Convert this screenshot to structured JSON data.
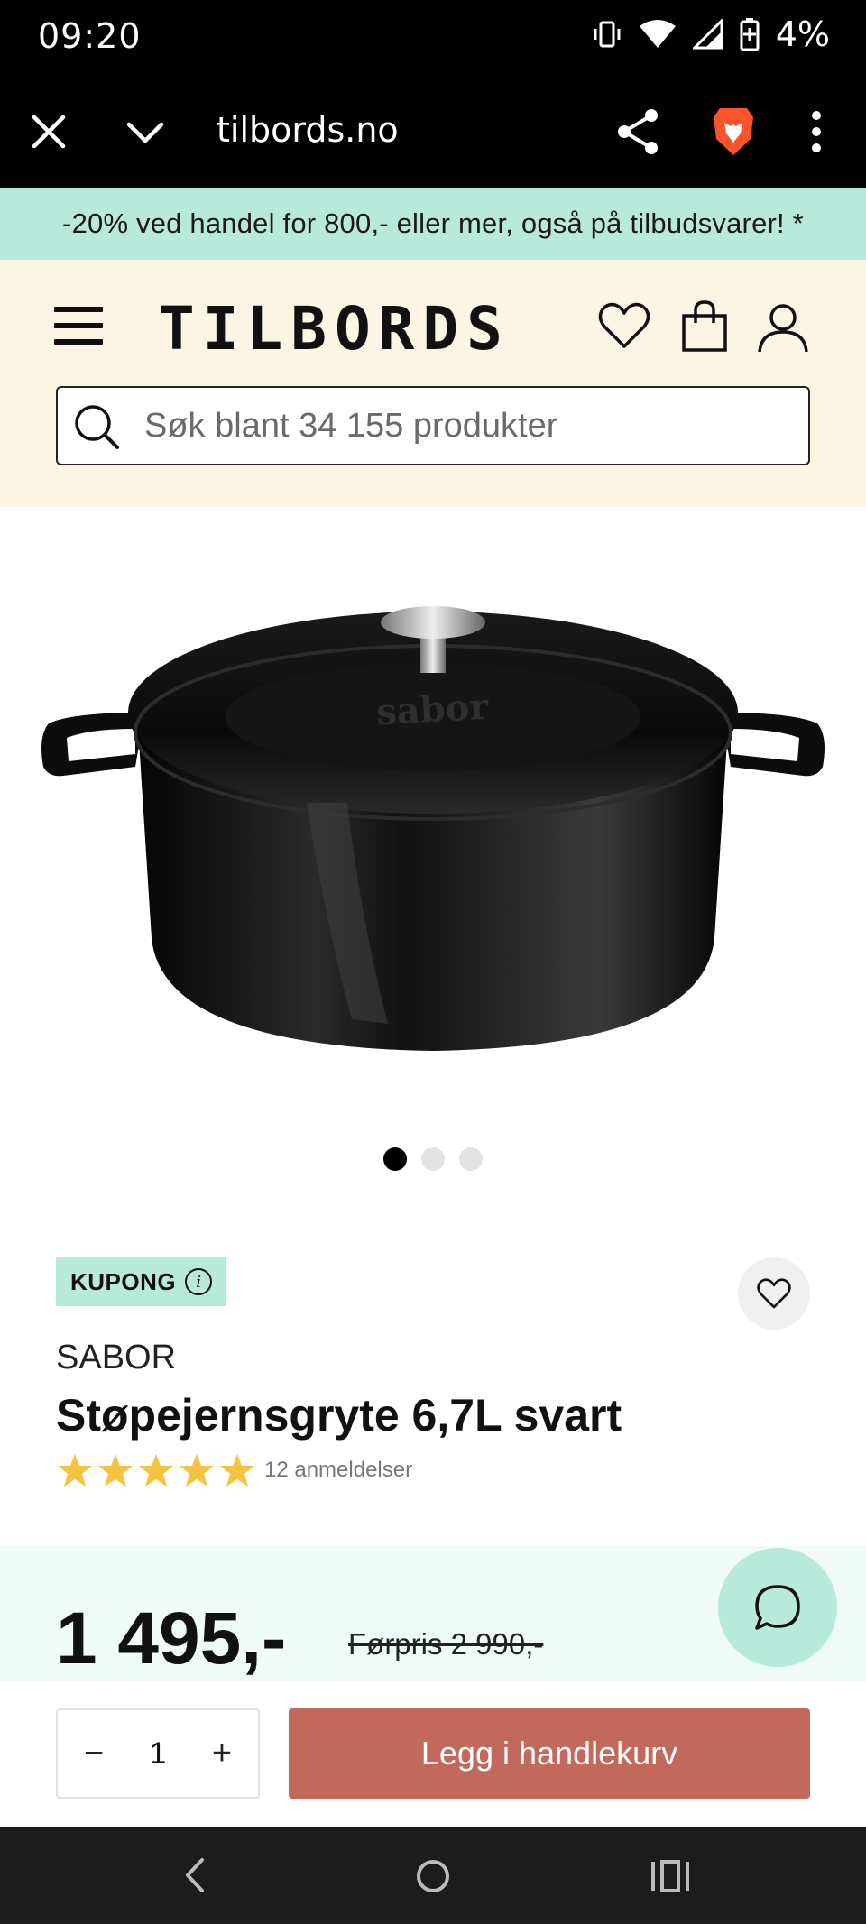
{
  "status_bar": {
    "time": "09:20",
    "battery": "4%"
  },
  "browser": {
    "url": "tilbords.no"
  },
  "promo": {
    "text": "-20% ved handel for 800,- eller mer, også på tilbudsvarer! *"
  },
  "header": {
    "logo": "TILBORDS",
    "search_placeholder": "Søk blant 34 155 produkter"
  },
  "gallery": {
    "image_count": 3,
    "active_index": 0
  },
  "product": {
    "coupon_label": "KUPONG",
    "coupon_info": "i",
    "brand": "SABOR",
    "title": "Støpejernsgryte 6,7L svart",
    "rating_stars": 5,
    "review_count": "12 anmeldelser",
    "price": "1 495,-",
    "old_price": "Førpris 2 990,-"
  },
  "cart": {
    "minus": "−",
    "quantity": "1",
    "plus": "+",
    "add_label": "Legg i handlekurv"
  },
  "colors": {
    "promo_bg": "#b7eadb",
    "header_bg": "#fbf5e4",
    "add_to_cart": "#c3695b",
    "star": "#f5c342"
  },
  "icons": [
    "close-icon",
    "chevron-down-icon",
    "share-icon",
    "brave-lion-icon",
    "more-vert-icon",
    "menu-icon",
    "heart-icon",
    "shopping-bag-icon",
    "user-icon",
    "search-icon",
    "chat-icon",
    "back-icon",
    "home-icon",
    "recents-icon"
  ]
}
